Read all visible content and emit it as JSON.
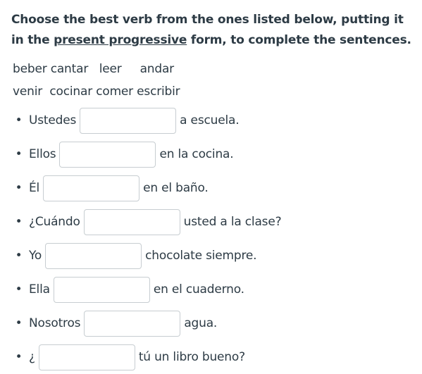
{
  "instructions": {
    "before": "Choose the best verb from the ones listed below, putting it in the ",
    "link": "present progressive",
    "after": " form, to complete the sentences."
  },
  "word_bank": {
    "row1": "beber cantar   leer     andar",
    "row2": "venir  cocinar comer escribir"
  },
  "items": [
    {
      "before": "Ustedes",
      "after": "a escuela.",
      "value": ""
    },
    {
      "before": "Ellos",
      "after": "en la cocina.",
      "value": ""
    },
    {
      "before": "Él",
      "after": "en el baño.",
      "value": ""
    },
    {
      "before": "¿Cuándo",
      "after": "usted a la clase?",
      "value": ""
    },
    {
      "before": "Yo",
      "after": "chocolate siempre.",
      "value": ""
    },
    {
      "before": "Ella",
      "after": "en el cuaderno.",
      "value": ""
    },
    {
      "before": "Nosotros",
      "after": "agua.",
      "value": ""
    },
    {
      "before": "¿",
      "after": "tú un libro bueno?",
      "value": ""
    }
  ]
}
